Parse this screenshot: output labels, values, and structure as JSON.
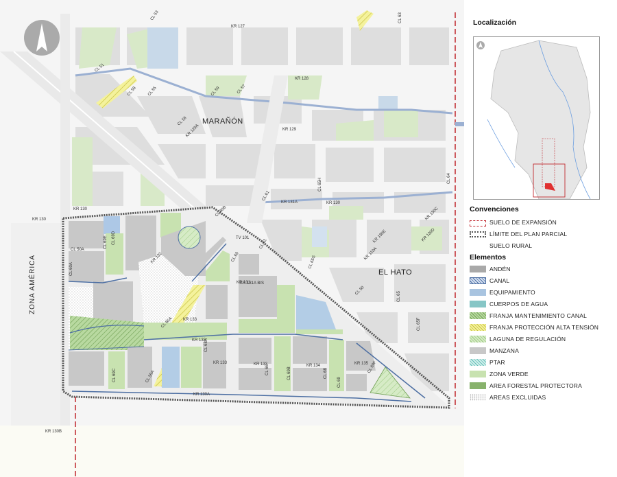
{
  "map": {
    "neighborhoods": [
      "MARAÑÓN",
      "EL HATO"
    ],
    "avenue": "ZONA AMÉRICA",
    "street_labels": [
      "KR 127",
      "KR 128",
      "KR 129",
      "KR 130",
      "KR 130",
      "KR 130",
      "KR 131",
      "KR 131A",
      "KR 131A BIS",
      "KR 132",
      "KR 133",
      "KR 133",
      "KR 133",
      "KR 133",
      "KR 134",
      "KR 135",
      "KR 130A",
      "KR 130B",
      "KR 130C",
      "KR 130D",
      "KR 130E",
      "KR 110A",
      "CL 50",
      "CL 50A",
      "CL 51",
      "CL 53",
      "CL 55",
      "CL 56",
      "CL 57",
      "CL 58",
      "CL 59",
      "CL 60",
      "CL 61",
      "CL 62",
      "CL 63",
      "CL 64",
      "CL 65",
      "CL 65F",
      "CL 65G",
      "CL 65H",
      "CL 66",
      "CL 68",
      "CL 69",
      "CL 69B",
      "CL 69C",
      "CL 69D",
      "CL 69E",
      "CL 69F",
      "CL 60A",
      "CL 68A",
      "CL 55A",
      "CL 65A",
      "KR 129A",
      "TV 101",
      "CL 60B"
    ]
  },
  "panel": {
    "localizacion_title": "Localización",
    "convenciones_title": "Convenciones",
    "convenciones": [
      {
        "label": "SUELO DE EXPANSIÓN",
        "style": "dash-red"
      },
      {
        "label": "LÍMITE DEL PLAN PARCIAL",
        "style": "dot-black"
      },
      {
        "label": "SUELO RURAL",
        "style": "plain"
      }
    ],
    "elementos_title": "Elementos",
    "elementos": [
      {
        "label": "ANDÉN",
        "color": "#a9a9a9",
        "pattern": "solid"
      },
      {
        "label": "CANAL",
        "color": "#c9d6ee",
        "pattern": "hatch-blue"
      },
      {
        "label": "EQUIPAMIENTO",
        "color": "#a9c4e0",
        "pattern": "solid"
      },
      {
        "label": "CUERPOS DE AGUA",
        "color": "#86c6c6",
        "pattern": "solid"
      },
      {
        "label": "FRANJA MANTENIMIENTO CANAL",
        "color": "#a8cf8e",
        "pattern": "hatch-green"
      },
      {
        "label": "FRANJA PROTECCIÓN ALTA TENSIÓN",
        "color": "#f1f09a",
        "pattern": "hatch-yellow"
      },
      {
        "label": "LAGUNA DE REGULACIÓN",
        "color": "#9fd19c",
        "pattern": "hatch-lightgreen"
      },
      {
        "label": "MANZANA",
        "color": "#c8c8c8",
        "pattern": "solid"
      },
      {
        "label": "PTAR",
        "color": "#c8ece8",
        "pattern": "hatch-teal"
      },
      {
        "label": "ZONA VERDE",
        "color": "#c8e2b0",
        "pattern": "solid"
      },
      {
        "label": "AREA FORESTAL PROTECTORA",
        "color": "#88b26c",
        "pattern": "solid"
      },
      {
        "label": "AREAS EXCLUIDAS",
        "color": "#ffffff",
        "pattern": "dots"
      }
    ]
  },
  "colors": {
    "block": "#dcdcdc",
    "street": "#f3f3f3",
    "plan_block": "#cfcfcf",
    "green": "#d4e7c2",
    "blue_block": "#b3cde6",
    "red_boundary": "#c0262d",
    "canal": "#4d6fa3",
    "yellow": "#f4f29c"
  }
}
